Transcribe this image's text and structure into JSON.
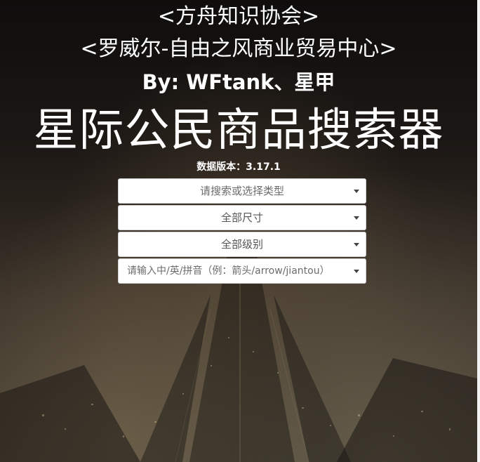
{
  "header": {
    "org_line": "<方舟知识协会>",
    "center_line": "<罗威尔-自由之风商业贸易中心>",
    "authors_line": "By: WFtank、星甲",
    "app_title": "星际公民商品搜索器",
    "data_version": "数据版本：3.17.1"
  },
  "filters": {
    "type_select": {
      "placeholder": "请搜索或选择类型"
    },
    "size_select": {
      "selected": "全部尺寸"
    },
    "grade_select": {
      "selected": "全部级别"
    },
    "name_search": {
      "placeholder": "请输入中/英/拼音（例：箭头/arrow/jiantou）"
    }
  },
  "colors": {
    "text": "#ffffff",
    "select_bg": "#ffffff",
    "select_text": "#555555"
  }
}
